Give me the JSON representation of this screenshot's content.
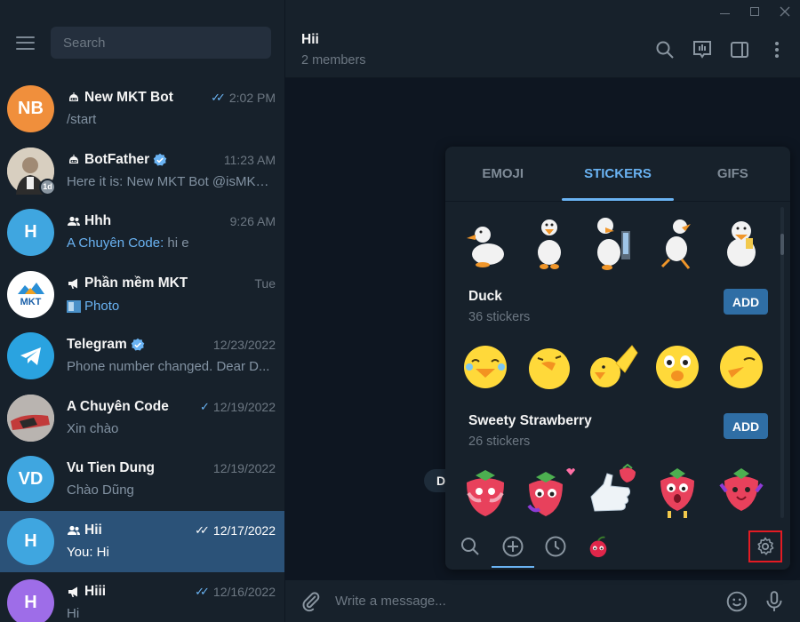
{
  "sidebar": {
    "search_placeholder": "Search",
    "chats": [
      {
        "initials": "NB",
        "avatar_color": "#f08f3c",
        "name": "New MKT Bot",
        "time": "2:02 PM",
        "preview": "/start",
        "checks": "✓✓",
        "type_icon": "bot-icon"
      },
      {
        "initials": "",
        "avatar_color": "#cdbfa8",
        "name": "BotFather",
        "time": "11:23 AM",
        "preview": "Here it is: New MKT Bot @isMKT_...",
        "badge": "1d",
        "type_icon": "bot-icon",
        "verified": true
      },
      {
        "initials": "H",
        "avatar_color": "#3fa6e0",
        "name": "Hhh",
        "time": "9:26 AM",
        "sender": "A Chuyên Code",
        "preview": "hi e",
        "type_icon": "group-icon"
      },
      {
        "initials": "",
        "avatar_color": "#ffffff",
        "avatar_text": "MKT",
        "name": "Phần mềm MKT",
        "time": "Tue",
        "preview": "Photo",
        "type_icon": "channel-icon"
      },
      {
        "initials": "",
        "avatar_color": "#2aa3e0",
        "name": "Telegram",
        "time": "12/23/2022",
        "preview": "Phone number changed. Dear D...",
        "verified": true
      },
      {
        "initials": "",
        "avatar_color": "#c4c4c4",
        "name": "A Chuyên Code",
        "time": "12/19/2022",
        "preview": "Xin chào",
        "checks": "✓"
      },
      {
        "initials": "VD",
        "avatar_color": "#3fa6e0",
        "name": "Vu Tien Dung",
        "time": "12/19/2022",
        "preview": "Chào Dũng"
      },
      {
        "initials": "H",
        "avatar_color": "#3fa6e0",
        "name": "Hii",
        "time": "12/17/2022",
        "preview": "You: Hi",
        "checks": "✓✓",
        "type_icon": "group-icon",
        "active": true
      },
      {
        "initials": "H",
        "avatar_color": "#9e6de8",
        "name": "Hiii",
        "time": "12/16/2022",
        "preview": "Hi",
        "checks": "✓✓",
        "type_icon": "channel-icon"
      }
    ]
  },
  "header": {
    "title": "Hii",
    "subtitle": "2 members"
  },
  "date_pill": "D",
  "composer": {
    "placeholder": "Write a message..."
  },
  "panel": {
    "tabs": [
      "EMOJI",
      "STICKERS",
      "GIFS"
    ],
    "active_tab": "STICKERS",
    "sets": [
      {
        "title": "Duck",
        "count": "36 stickers",
        "add_label": "ADD"
      },
      {
        "title": "Sweety Strawberry",
        "count": "26 stickers",
        "add_label": "ADD"
      }
    ]
  },
  "colors": {
    "accent": "#6ab3f3",
    "active_chat": "#2b5278",
    "highlight_box": "#e31b23"
  }
}
